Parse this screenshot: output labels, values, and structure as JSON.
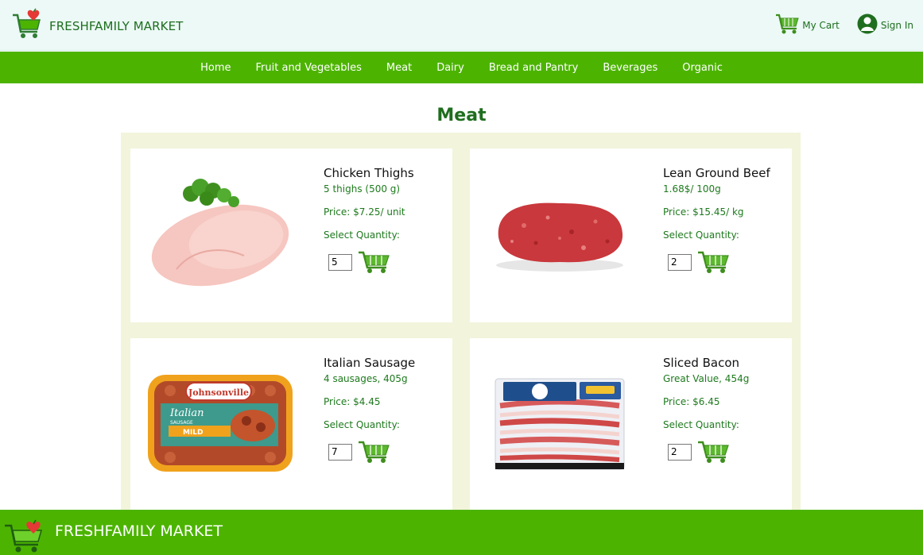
{
  "header": {
    "brand": "FRESHFAMILY MARKET",
    "cart_label": "My Cart",
    "signin_label": "Sign In"
  },
  "nav": {
    "items": [
      {
        "label": "Home"
      },
      {
        "label": "Fruit and Vegetables"
      },
      {
        "label": "Meat"
      },
      {
        "label": "Dairy"
      },
      {
        "label": "Bread and Pantry"
      },
      {
        "label": "Beverages"
      },
      {
        "label": "Organic"
      }
    ]
  },
  "page": {
    "title": "Meat"
  },
  "products": [
    {
      "name": "Chicken Thighs",
      "desc": "5 thighs (500 g)",
      "price": "Price: $7.25/ unit",
      "qty_label": "Select Quantity:",
      "qty": "5"
    },
    {
      "name": "Lean Ground Beef",
      "desc": "1.68$/ 100g",
      "price": "Price: $15.45/ kg",
      "qty_label": "Select Quantity:",
      "qty": "2"
    },
    {
      "name": "Italian Sausage",
      "desc": "4 sausages, 405g",
      "price": "Price: $4.45",
      "qty_label": "Select Quantity:",
      "qty": "7"
    },
    {
      "name": "Sliced Bacon",
      "desc": "Great Value, 454g",
      "price": "Price: $6.45",
      "qty_label": "Select Quantity:",
      "qty": "2"
    }
  ],
  "packaging": {
    "brand": "Johnsonville",
    "flavor": "Italian",
    "type": "SAUSAGE",
    "variety": "MILD"
  },
  "footer": {
    "brand": "FRESHFAMILY MARKET"
  },
  "colors": {
    "green_primary": "#4cb400",
    "green_text": "#1e6e1e",
    "header_bg": "#ecf9f6",
    "grid_bg": "#f2f4dc"
  }
}
